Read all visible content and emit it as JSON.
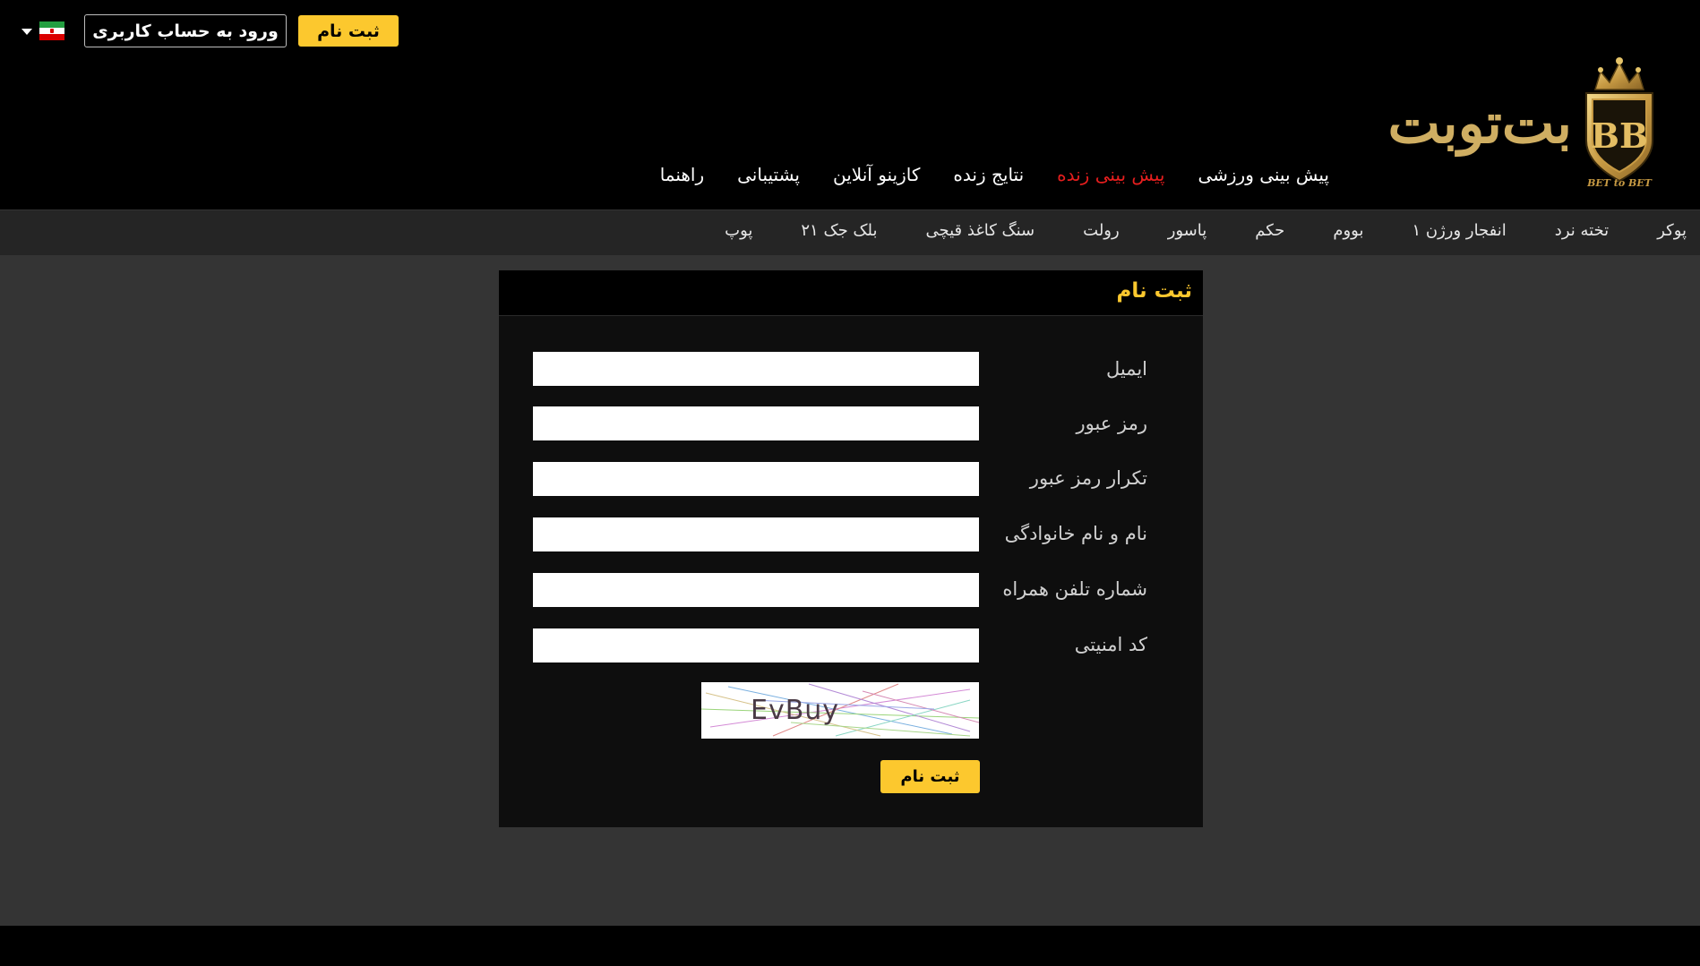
{
  "header": {
    "register_label": "ثبت نام",
    "login_label": "ورود به حساب کاربری",
    "language_flag": "iran-flag-icon",
    "logo_text": "بت‌توبت",
    "logo_emblem_text": "BB",
    "logo_tagline": "BET to BET"
  },
  "main_nav": [
    {
      "label": "پیش بینی ورزشی",
      "active": false
    },
    {
      "label": "پیش بینی زنده",
      "active": true
    },
    {
      "label": "نتایج زنده",
      "active": false
    },
    {
      "label": "کازینو آنلاین",
      "active": false
    },
    {
      "label": "پشتیبانی",
      "active": false
    },
    {
      "label": "راهنما",
      "active": false
    }
  ],
  "sub_nav": [
    "پوکر",
    "تخته نرد",
    "انفجار ورژن ۱",
    "بووم",
    "حکم",
    "پاسور",
    "رولت",
    "سنگ کاغذ قیچی",
    "بلک جک ۲۱",
    "پوپ"
  ],
  "form": {
    "title": "ثبت نام",
    "fields": [
      {
        "label": "ایمیل",
        "value": ""
      },
      {
        "label": "رمز عبور",
        "value": ""
      },
      {
        "label": "تکرار رمز عبور",
        "value": ""
      },
      {
        "label": "نام و نام خانوادگی",
        "value": ""
      },
      {
        "label": "شماره تلفن همراه",
        "value": ""
      },
      {
        "label": "کد امنیتی",
        "value": ""
      }
    ],
    "captcha_text": "EvBuy",
    "submit_label": "ثبت نام"
  },
  "colors": {
    "accent": "#fcc82e",
    "active_nav": "#e61e1e",
    "header_bg": "#000000",
    "page_bg": "#343434"
  }
}
